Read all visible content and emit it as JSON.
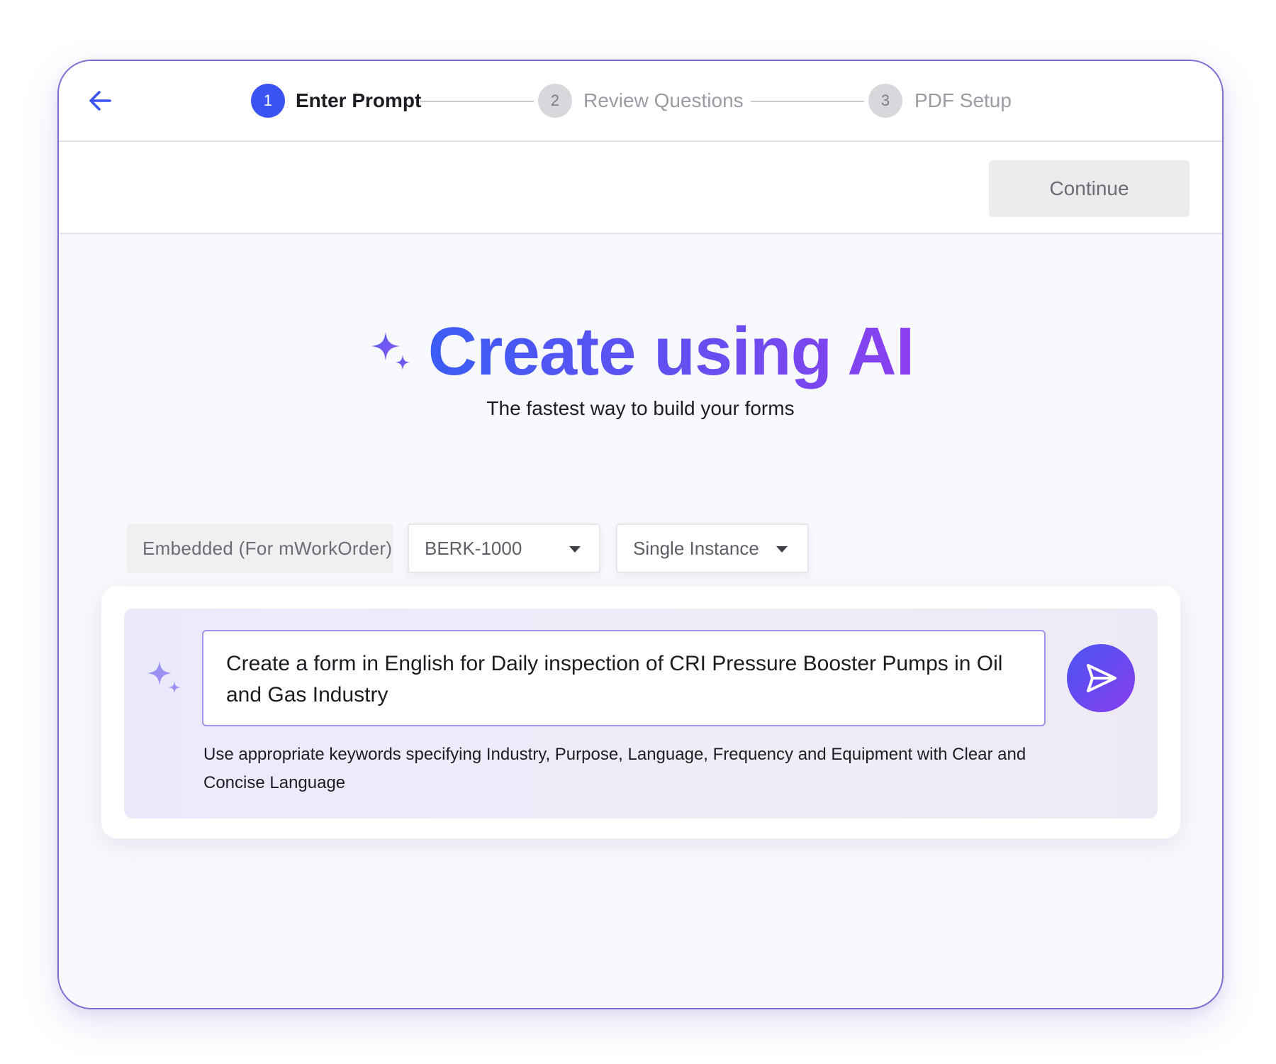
{
  "stepper": {
    "steps": [
      {
        "number": "1",
        "label": "Enter Prompt",
        "state": "active"
      },
      {
        "number": "2",
        "label": "Review Questions",
        "state": "inactive"
      },
      {
        "number": "3",
        "label": "PDF Setup",
        "state": "inactive"
      }
    ],
    "back_icon": "arrow-left-icon"
  },
  "actions": {
    "continue_label": "Continue"
  },
  "hero": {
    "title": "Create using AI",
    "subtitle": "The fastest way to build your forms",
    "icon": "sparkle-icon"
  },
  "selectors": {
    "mode_label": "Embedded (For mWorkOrder)",
    "asset_value": "BERK-1000",
    "instance_value": "Single Instance"
  },
  "prompt": {
    "value": "Create a form in English for Daily inspection of CRI Pressure Booster Pumps in Oil and Gas Industry",
    "helper": "Use appropriate keywords specifying Industry, Purpose, Language, Frequency and Equipment with Clear and Concise Language",
    "send_icon": "send-icon",
    "sparkle_icon": "sparkle-icon"
  },
  "colors": {
    "accent": "#3b53f2",
    "gradient_start": "#3b5cf5",
    "gradient_end": "#8b3ff0",
    "border": "#7b6fd3"
  }
}
